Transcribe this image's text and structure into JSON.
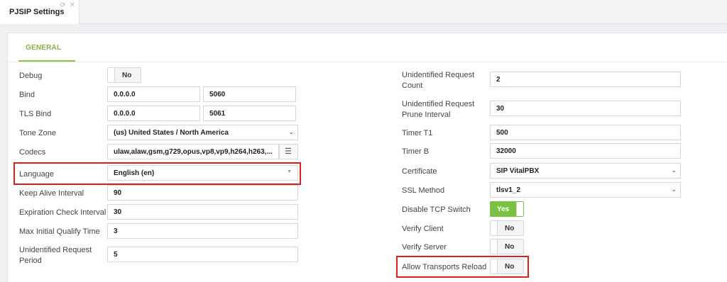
{
  "tab": {
    "title": "PJSIP Settings",
    "icons": [
      "refresh-icon",
      "close-icon"
    ],
    "refresh_glyph": "⟳",
    "close_glyph": "✕"
  },
  "subtab": {
    "label": "GENERAL",
    "accent": "#8cc63f"
  },
  "left": {
    "debug": {
      "label": "Debug",
      "toggle": "No"
    },
    "bind": {
      "label": "Bind",
      "address": "0.0.0.0",
      "port": "5060"
    },
    "tls_bind": {
      "label": "TLS Bind",
      "address": "0.0.0.0",
      "port": "5061"
    },
    "tone_zone": {
      "label": "Tone Zone",
      "value": "(us) United States / North America"
    },
    "codecs": {
      "label": "Codecs",
      "value": "ulaw,alaw,gsm,g729,opus,vp8,vp9,h264,h263,..."
    },
    "language": {
      "label": "Language",
      "value": "English (en)"
    },
    "keep_alive": {
      "label": "Keep Alive Interval",
      "value": "90"
    },
    "expiration": {
      "label": "Expiration Check Interval",
      "value": "30"
    },
    "max_qualify": {
      "label": "Max Initial Qualify Time",
      "value": "3"
    },
    "unid_period": {
      "label_1": "Unidentified Request",
      "label_2": "Period",
      "value": "5"
    }
  },
  "right": {
    "unid_count": {
      "label_1": "Unidentified Request",
      "label_2": "Count",
      "value": "2"
    },
    "unid_prune": {
      "label_1": "Unidentified Request",
      "label_2": "Prune Interval",
      "value": "30"
    },
    "timer_t1": {
      "label": "Timer T1",
      "value": "500"
    },
    "timer_b": {
      "label": "Timer B",
      "value": "32000"
    },
    "certificate": {
      "label": "Certificate",
      "value": "SIP VitalPBX"
    },
    "ssl_method": {
      "label": "SSL Method",
      "value": "tlsv1_2"
    },
    "disable_tcp": {
      "label": "Disable TCP Switch",
      "toggle": "Yes"
    },
    "verify_client": {
      "label": "Verify Client",
      "toggle": "No"
    },
    "verify_server": {
      "label": "Verify Server",
      "toggle": "No"
    },
    "allow_reload": {
      "label": "Allow Transports Reload",
      "toggle": "No"
    }
  },
  "colors": {
    "toggle_on": "#7cc242",
    "highlight": "#e01e1e"
  }
}
